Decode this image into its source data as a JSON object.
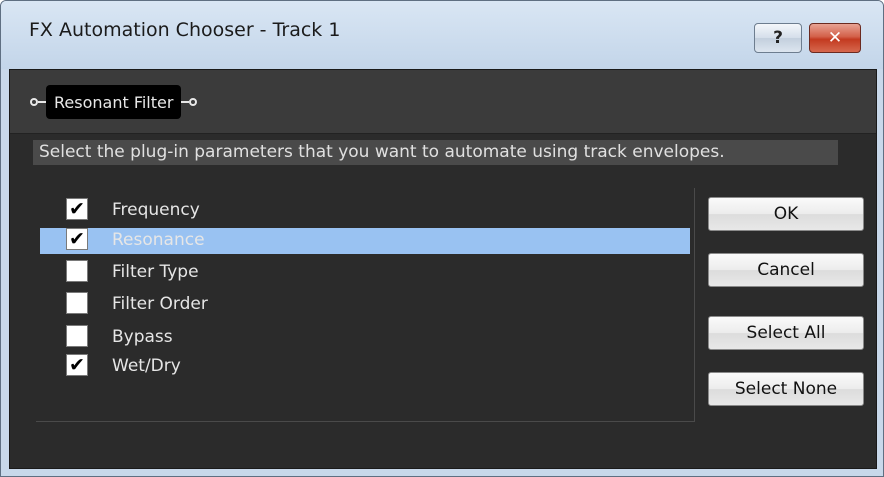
{
  "window": {
    "title": "FX Automation Chooser - Track 1",
    "help_label": "?",
    "close_label": "✕"
  },
  "plugin_chain": {
    "active_plugin": "Resonant Filter"
  },
  "instruction": "Select the plug-in parameters that you want to automate using track envelopes.",
  "parameters": [
    {
      "label": "Frequency",
      "checked": true,
      "selected": false
    },
    {
      "label": "Resonance",
      "checked": true,
      "selected": true
    },
    {
      "label": "Filter Type",
      "checked": false,
      "selected": false
    },
    {
      "label": "Filter Order",
      "checked": false,
      "selected": false
    },
    {
      "label": "Bypass",
      "checked": false,
      "selected": false
    },
    {
      "label": "Wet/Dry",
      "checked": true,
      "selected": false
    }
  ],
  "buttons": {
    "ok": "OK",
    "cancel": "Cancel",
    "select_all": "Select All",
    "select_none": "Select None"
  },
  "colors": {
    "selection": "#99c2f2",
    "panel_background": "#2b2b2b",
    "close_button": "#c33a20"
  }
}
